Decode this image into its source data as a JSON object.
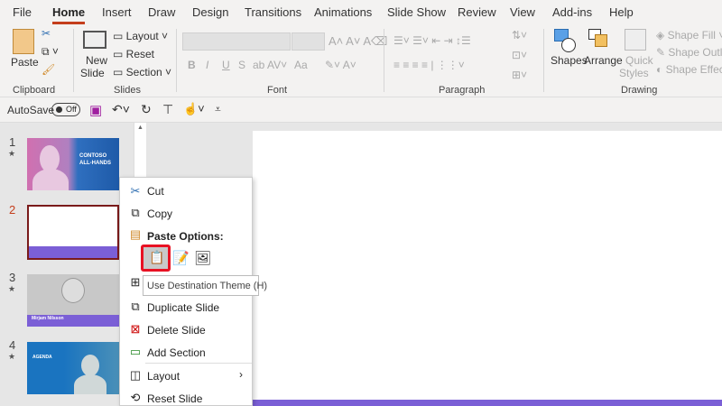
{
  "tabs": [
    "File",
    "Home",
    "Insert",
    "Draw",
    "Design",
    "Transitions",
    "Animations",
    "Slide Show",
    "Review",
    "View",
    "Add-ins",
    "Help"
  ],
  "active_tab": "Home",
  "ribbon": {
    "clipboard": {
      "label": "Clipboard",
      "paste": "Paste"
    },
    "slides": {
      "label": "Slides",
      "new_slide_1": "New",
      "new_slide_2": "Slide",
      "layout": "Layout",
      "reset": "Reset",
      "section": "Section"
    },
    "font": {
      "label": "Font",
      "bold": "B",
      "italic": "I",
      "underline": "U",
      "shadow": "S",
      "case": "Aa"
    },
    "paragraph": {
      "label": "Paragraph"
    },
    "drawing": {
      "label": "Drawing",
      "shapes": "Shapes",
      "arrange": "Arrange",
      "quick_styles_1": "Quick",
      "quick_styles_2": "Styles",
      "shape_fill": "Shape Fill",
      "shape_outline": "Shape Outline",
      "shape_effects": "Shape Effects"
    }
  },
  "qat": {
    "autosave": "AutoSave",
    "toggle": "Off"
  },
  "thumbnails": [
    {
      "num": "1",
      "title": "CONTOSO ALL-HANDS"
    },
    {
      "num": "2",
      "title": ""
    },
    {
      "num": "3",
      "title": "Mirjam Nilsson"
    },
    {
      "num": "4",
      "title": "AGENDA"
    }
  ],
  "context_menu": {
    "cut": "Cut",
    "copy": "Copy",
    "paste_options": "Paste Options:",
    "duplicate": "Duplicate Slide",
    "delete": "Delete Slide",
    "add_section": "Add Section",
    "layout": "Layout",
    "reset": "Reset Slide"
  },
  "tooltip": "Use Destination Theme (H)",
  "colors": {
    "accent": "#c43e1c",
    "slide_bar": "#7b5fd6",
    "highlight": "#e81123"
  }
}
